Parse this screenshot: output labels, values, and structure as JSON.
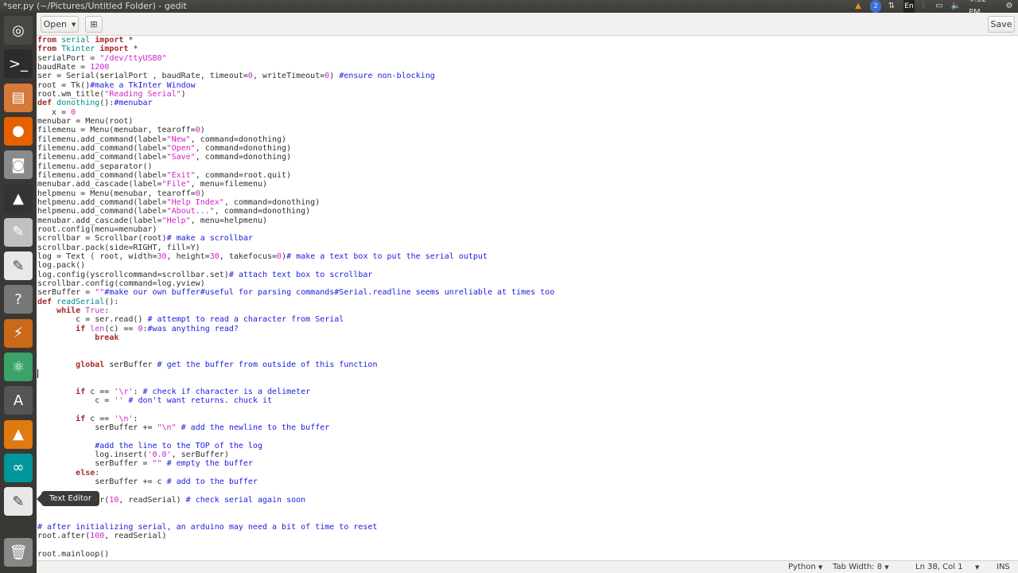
{
  "window_title": "*ser.py (~/Pictures/Untitled Folder) - gedit",
  "tray": {
    "clock": "4:52 PM",
    "keyboard": "En",
    "notification_count": "2"
  },
  "launcher": {
    "items": [
      {
        "name": "ubuntu-dash",
        "icon": "ubuntu-logo-icon",
        "color": "#4a4845"
      },
      {
        "name": "terminal",
        "icon": "terminal-icon",
        "color": "#2c2c2c"
      },
      {
        "name": "files",
        "icon": "file-cabinet-icon",
        "color": "#d57a3a"
      },
      {
        "name": "firefox",
        "icon": "firefox-icon",
        "color": "#e66000"
      },
      {
        "name": "camera",
        "icon": "camera-icon",
        "color": "#8a8a8a"
      },
      {
        "name": "inkscape",
        "icon": "inkscape-icon",
        "color": "#333"
      },
      {
        "name": "image-editor",
        "icon": "paint-icon",
        "color": "#c0c0c0"
      },
      {
        "name": "text-editor-2",
        "icon": "text-editor-icon",
        "color": "#e8e8e8"
      },
      {
        "name": "help",
        "icon": "question-icon",
        "color": "#777"
      },
      {
        "name": "fritzing",
        "icon": "fritzing-icon",
        "color": "#c96a1a"
      },
      {
        "name": "atom",
        "icon": "atom-icon",
        "color": "#3aa36a"
      },
      {
        "name": "software-updater",
        "icon": "update-icon",
        "color": "#555"
      },
      {
        "name": "vlc",
        "icon": "vlc-icon",
        "color": "#e07a10"
      },
      {
        "name": "arduino",
        "icon": "arduino-icon",
        "color": "#00979c"
      },
      {
        "name": "text-editor",
        "icon": "text-editor-icon",
        "color": "#e8e8e8"
      },
      {
        "name": "trash",
        "icon": "trash-icon",
        "color": "#888"
      }
    ],
    "tooltip": "Text Editor"
  },
  "toolbar": {
    "open_label": "Open",
    "save_label": "Save"
  },
  "code_lines": [
    "from serial import *",
    "from Tkinter import *",
    "serialPort = \"/dev/ttyUSB0\"",
    "baudRate = 1200",
    "ser = Serial(serialPort , baudRate, timeout=0, writeTimeout=0) #ensure non-blocking",
    "root = Tk()#make a TkInter Window",
    "root.wm_title(\"Reading Serial\")",
    "def donothing():#menubar",
    "   x = 0",
    "menubar = Menu(root)",
    "filemenu = Menu(menubar, tearoff=0)",
    "filemenu.add_command(label=\"New\", command=donothing)",
    "filemenu.add_command(label=\"Open\", command=donothing)",
    "filemenu.add_command(label=\"Save\", command=donothing)",
    "filemenu.add_separator()",
    "filemenu.add_command(label=\"Exit\", command=root.quit)",
    "menubar.add_cascade(label=\"File\", menu=filemenu)",
    "helpmenu = Menu(menubar, tearoff=0)",
    "helpmenu.add_command(label=\"Help Index\", command=donothing)",
    "helpmenu.add_command(label=\"About...\", command=donothing)",
    "menubar.add_cascade(label=\"Help\", menu=helpmenu)",
    "root.config(menu=menubar)",
    "scrollbar = Scrollbar(root)# make a scrollbar",
    "scrollbar.pack(side=RIGHT, fill=Y)",
    "log = Text ( root, width=30, height=30, takefocus=0)# make a text box to put the serial output",
    "log.pack()",
    "log.config(yscrollcommand=scrollbar.set)# attach text box to scrollbar",
    "scrollbar.config(command=log.yview)",
    "serBuffer = \"\"#make our own buffer#useful for parsing commands#Serial.readline seems unreliable at times too",
    "def readSerial():",
    "    while True:",
    "        c = ser.read() # attempt to read a character from Serial",
    "        if len(c) == 0:#was anything read?",
    "            break",
    "",
    "",
    "        global serBuffer # get the buffer from outside of this function",
    "",
    "",
    "        if c == '\\r': # check if character is a delimeter",
    "            c = '' # don't want returns. chuck it",
    "",
    "        if c == '\\n':",
    "            serBuffer += \"\\n\" # add the newline to the buffer",
    "",
    "            #add the line to the TOP of the log",
    "            log.insert('0.0', serBuffer)",
    "            serBuffer = \"\" # empty the buffer",
    "        else:",
    "            serBuffer += c # add to the buffer",
    "",
    "    root.after(10, readSerial) # check serial again soon",
    "",
    "",
    "# after initializing serial, an arduino may need a bit of time to reset",
    "root.after(100, readSerial)",
    "",
    "root.mainloop()"
  ],
  "statusbar": {
    "language": "Python",
    "tab_width": "Tab Width: 8",
    "position": "Ln 38, Col 1",
    "mode": "INS"
  }
}
